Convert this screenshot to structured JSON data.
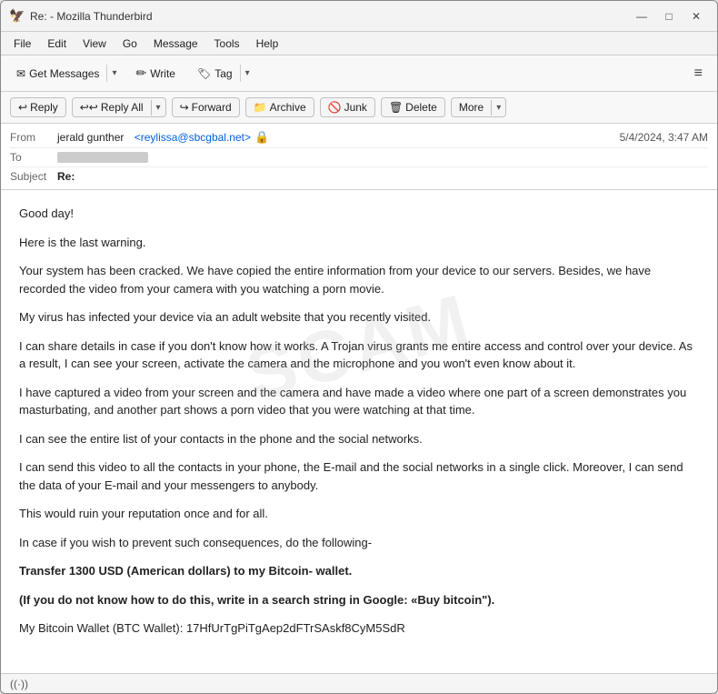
{
  "window": {
    "title": "Re: - Mozilla Thunderbird",
    "icon": "🦅"
  },
  "titlebar_controls": {
    "minimize": "—",
    "maximize": "□",
    "close": "✕"
  },
  "menubar": {
    "items": [
      "File",
      "Edit",
      "View",
      "Go",
      "Message",
      "Tools",
      "Help"
    ]
  },
  "toolbar": {
    "get_messages_label": "Get Messages",
    "write_label": "Write",
    "tag_label": "Tag",
    "hamburger": "≡"
  },
  "action_bar": {
    "reply_label": "Reply",
    "reply_all_label": "Reply All",
    "forward_label": "Forward",
    "archive_label": "Archive",
    "junk_label": "Junk",
    "delete_label": "Delete",
    "more_label": "More"
  },
  "email": {
    "from_label": "From",
    "from_name": "jerald gunther",
    "from_email": "<reylissa@sbcgbal.net>",
    "to_label": "To",
    "date": "5/4/2024, 3:47 AM",
    "subject_label": "Subject",
    "subject_value": "Re:",
    "body": [
      "Good day!",
      "Here is the last warning.",
      "Your system has been cracked. We have copied the entire information from your device to our servers. Besides, we have recorded the video from your camera with you watching a porn movie.",
      "My virus has infected your device via an adult website that you recently visited.",
      "I can share details in case if you don't know how it works. A Trojan virus grants me entire access and control over your device. As a result, I can see your screen, activate the camera and the microphone and you won't even know about it.",
      "I have captured a video from your screen and the camera and have made a video where one part of a screen demonstrates you masturbating, and another part shows a porn video that you were watching at that time.",
      "I can see the entire list of your contacts in the phone and the social networks.",
      "I can send this video to all the contacts in your phone, the E-mail and the social networks in a single click. Moreover, I can send the data of your E-mail and your messengers to anybody.",
      "This would ruin your reputation once and for all.",
      "In case if you wish to prevent such consequences, do the following-",
      "Transfer 1300 USD (American dollars) to my Bitcoin- wallet.",
      "(If you do not know how to do this, write in a search string in Google: «Buy bitcoin\").",
      "My Bitcoin Wallet (BTC Wallet): 17HfUrTgPiTgAep2dFTrSAskf8CyM5SdR"
    ],
    "body_bold": [
      "Transfer 1300 USD (American dollars) to my Bitcoin- wallet.",
      "(If you do not know how to do this, write in a search string in Google: «Buy bitcoin\")."
    ]
  },
  "statusbar": {
    "icon": "((·))"
  }
}
